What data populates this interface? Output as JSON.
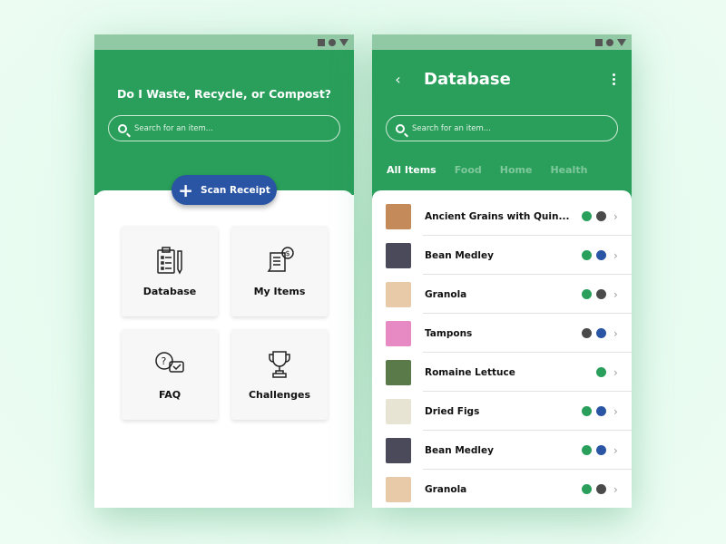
{
  "colors": {
    "green": "#2a9f5b",
    "blue": "#2a55a4",
    "dark": "#4a4a4a"
  },
  "home": {
    "title": "Do I Waste, Recycle, or Compost?",
    "search_placeholder": "Search for an item...",
    "scan_label": "Scan Receipt",
    "cards": [
      {
        "label": "Database",
        "icon": "clipboard-icon"
      },
      {
        "label": "My Items",
        "icon": "receipt-icon"
      },
      {
        "label": "FAQ",
        "icon": "faq-chat-icon"
      },
      {
        "label": "Challenges",
        "icon": "trophy-icon"
      }
    ]
  },
  "database": {
    "title": "Database",
    "search_placeholder": "Search for an item...",
    "tabs": [
      "All Items",
      "Food",
      "Home",
      "Health"
    ],
    "items": [
      {
        "name": "Ancient Grains with Quin...",
        "dots": [
          "green",
          "dark"
        ],
        "thumb": "#c48a5a"
      },
      {
        "name": "Bean Medley",
        "dots": [
          "green",
          "blue"
        ],
        "thumb": "#4b4a5a"
      },
      {
        "name": "Granola",
        "dots": [
          "green",
          "dark"
        ],
        "thumb": "#e8c9a8"
      },
      {
        "name": "Tampons",
        "dots": [
          "dark",
          "blue"
        ],
        "thumb": "#e78ac4"
      },
      {
        "name": "Romaine Lettuce",
        "dots": [
          "green"
        ],
        "thumb": "#5a7a4a"
      },
      {
        "name": "Dried Figs",
        "dots": [
          "green",
          "blue"
        ],
        "thumb": "#e8e4d4"
      },
      {
        "name": "Bean Medley",
        "dots": [
          "green",
          "blue"
        ],
        "thumb": "#4b4a5a"
      },
      {
        "name": "Granola",
        "dots": [
          "green",
          "dark"
        ],
        "thumb": "#e8c9a8"
      }
    ]
  }
}
